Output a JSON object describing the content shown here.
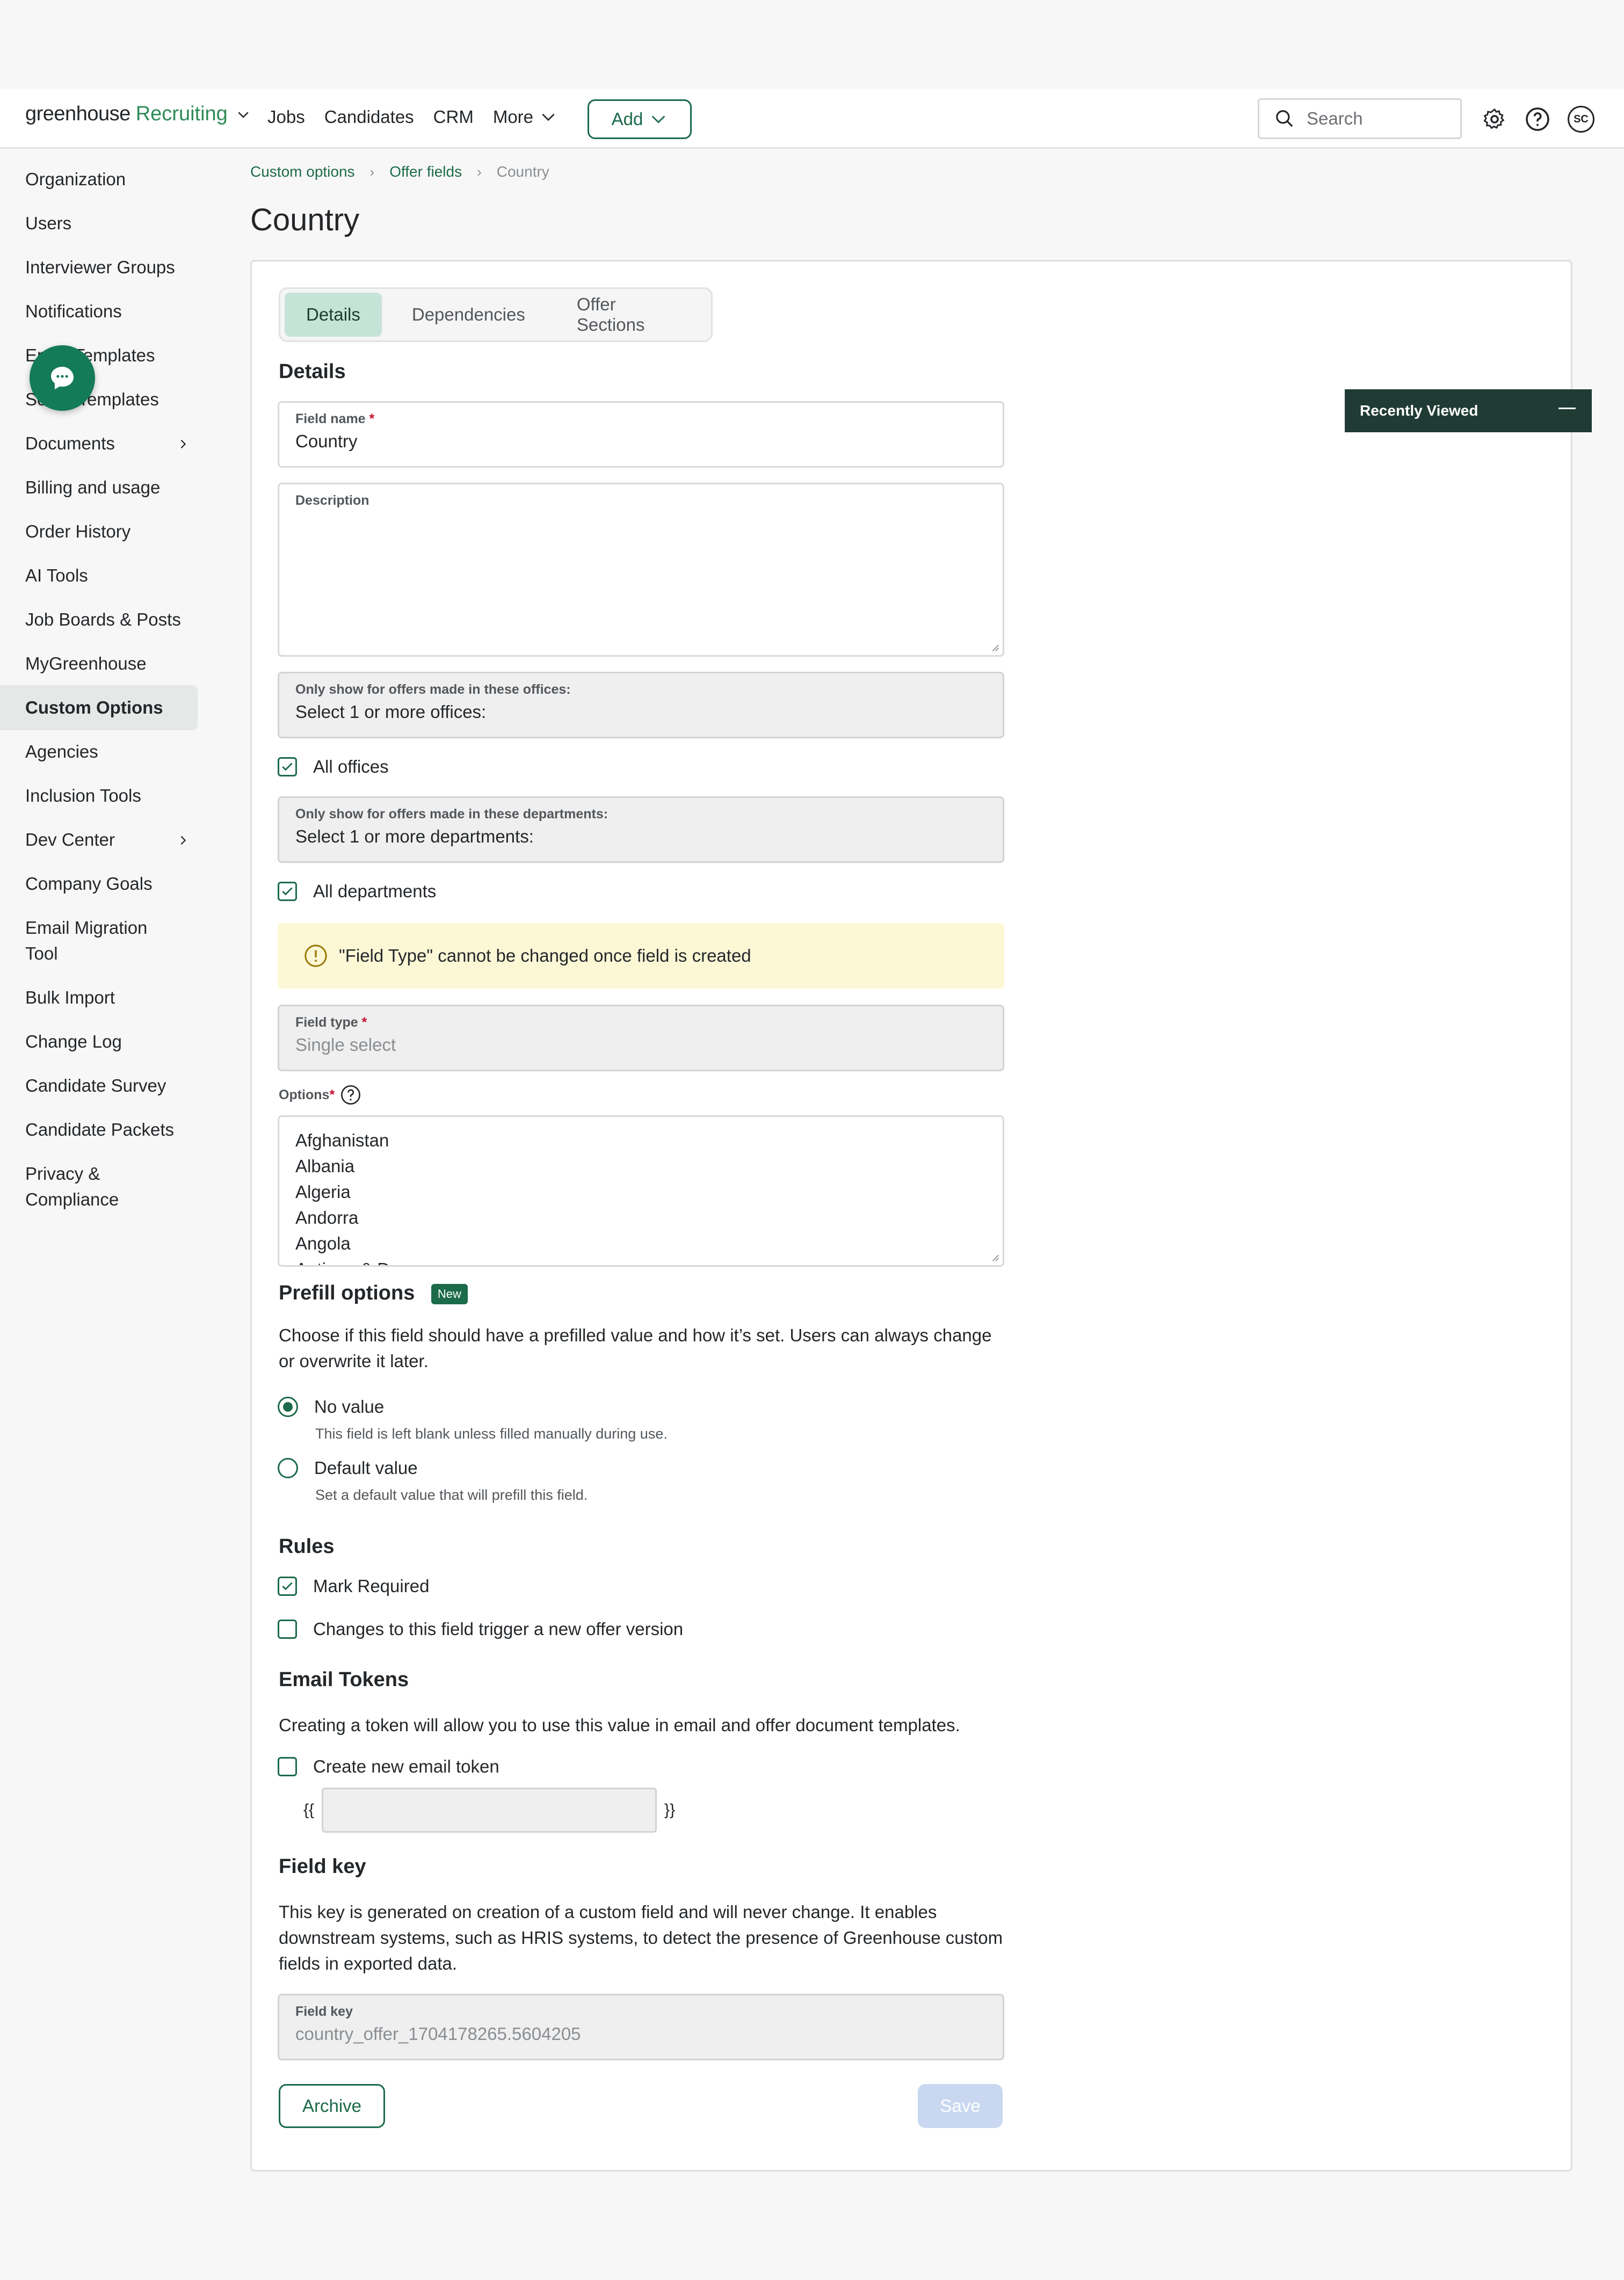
{
  "brand": {
    "name": "greenhouse",
    "product": "Recruiting"
  },
  "nav": {
    "links": [
      "Jobs",
      "Candidates",
      "CRM",
      "More"
    ],
    "add_label": "Add",
    "search_placeholder": "Search",
    "avatar_initials": "SC"
  },
  "sidebar": {
    "items": [
      "Organization",
      "Users",
      "Interviewer Groups",
      "Notifications",
      "Email Templates",
      "Social Templates",
      "Documents",
      "Billing and usage",
      "Order History",
      "AI Tools",
      "Job Boards & Posts",
      "MyGreenhouse",
      "Custom Options",
      "Agencies",
      "Inclusion Tools",
      "Dev Center",
      "Company Goals",
      "Email Migration Tool",
      "Bulk Import",
      "Change Log",
      "Candidate Survey",
      "Candidate Packets",
      "Privacy & Compliance"
    ],
    "active": "Custom Options"
  },
  "breadcrumb": {
    "level1": "Custom options",
    "level2": "Offer fields",
    "current": "Country"
  },
  "page_title": "Country",
  "tabs": [
    "Details",
    "Dependencies",
    "Offer Sections"
  ],
  "details": {
    "heading": "Details",
    "field_name_label": "Field name",
    "field_name_value": "Country",
    "description_label": "Description",
    "offices_label": "Only show for offers made in these offices:",
    "offices_placeholder": "Select 1 or more offices:",
    "all_offices": "All offices",
    "departments_label": "Only show for offers made in these departments:",
    "departments_placeholder": "Select 1 or more departments:",
    "all_departments": "All departments",
    "warning": "\"Field Type\" cannot be changed once field is created",
    "field_type_label": "Field type",
    "field_type_value": "Single select",
    "options_label": "Options",
    "options": [
      "Afghanistan",
      "Albania",
      "Algeria",
      "Andorra",
      "Angola",
      "Antigua & Deps"
    ]
  },
  "prefill": {
    "heading": "Prefill options",
    "badge": "New",
    "description": "Choose if this field should have a prefilled value and how it’s set. Users can always change or overwrite it later.",
    "no_value_label": "No value",
    "no_value_help": "This field is left blank unless filled manually during use.",
    "default_value_label": "Default value",
    "default_value_help": "Set a default value that will prefill this field.",
    "selected": "No value"
  },
  "rules": {
    "heading": "Rules",
    "mark_required": "Mark Required",
    "mark_required_checked": true,
    "new_offer_version": "Changes to this field trigger a new offer version",
    "new_offer_version_checked": false
  },
  "email_tokens": {
    "heading": "Email Tokens",
    "description": "Creating a token will allow you to use this value in email and offer document templates.",
    "create_label": "Create new email token",
    "open_brace": "{{",
    "close_brace": "}}"
  },
  "field_key": {
    "heading": "Field key",
    "description": "This key is generated on creation of a custom field and will never change. It enables downstream systems, such as HRIS systems, to detect the presence of Greenhouse custom fields in exported data.",
    "label": "Field key",
    "value": "country_offer_1704178265.5604205"
  },
  "actions": {
    "archive": "Archive",
    "save": "Save"
  },
  "recently_viewed": "Recently Viewed",
  "colors": {
    "brand_green": "#1c6b4a",
    "tab_active": "#c6e3d7",
    "warning_bg": "#fcf8d6",
    "save_disabled": "#c9d8f0"
  }
}
